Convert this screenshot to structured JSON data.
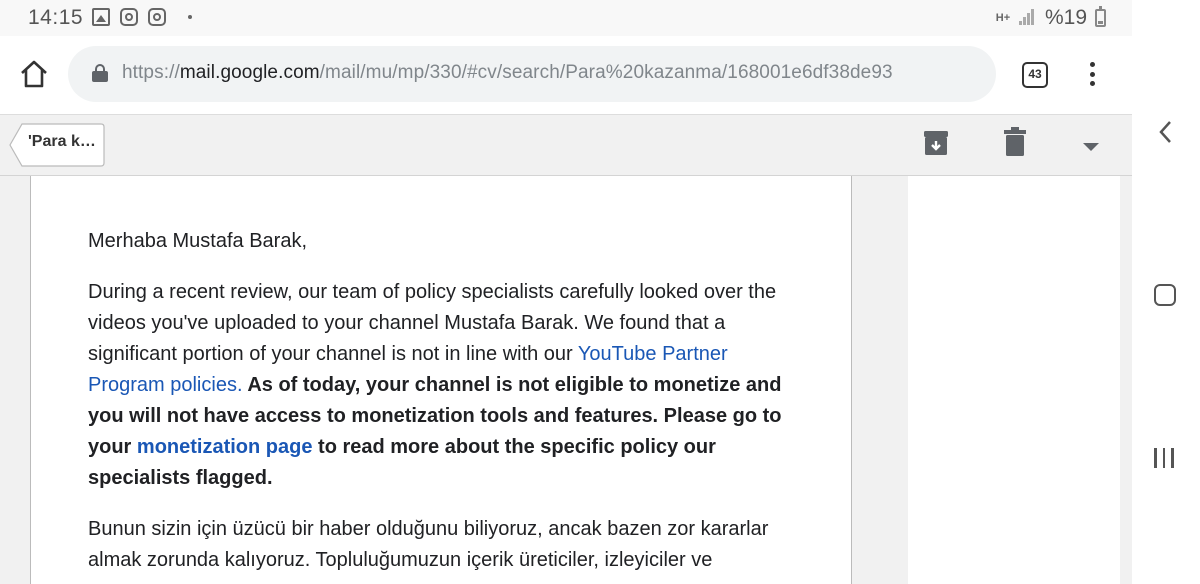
{
  "status_bar": {
    "time": "14:15",
    "notification_icons": [
      "gallery-icon",
      "instagram-icon",
      "instagram-icon",
      "dot-icon"
    ],
    "network_label": "H+",
    "battery_text": "%19"
  },
  "browser": {
    "url_scheme": "https://",
    "url_host": "mail.google.com",
    "url_path": "/mail/mu/mp/330/#cv/search/Para%20kazanma/168001e6df38de93",
    "tab_count": "43"
  },
  "toolbar": {
    "back_label": "'Para k…",
    "icons": [
      "archive-icon",
      "delete-icon",
      "dropdown-icon"
    ]
  },
  "email": {
    "greeting": "Merhaba Mustafa Barak,",
    "p1_text1": "During a recent review, our team of policy specialists carefully looked over the videos you've uploaded to your channel Mustafa Barak. We found that a significant portion of your channel is not in line with our ",
    "p1_link1": "YouTube Partner Program policies.",
    "p1_bold1": " As of today, your channel is not eligible to monetize and you will not have access to monetization tools and features. Please go to your ",
    "p1_link2": "monetization page",
    "p1_bold2": " to read more about the specific policy our specialists flagged.",
    "p2_text": "Bunun sizin için üzücü bir haber olduğunu biliyoruz, ancak bazen zor kararlar almak zorunda kalıyoruz. Topluluğumuzun içerik üreticiler, izleyiciler ve"
  },
  "colors": {
    "link": "#1a57b5",
    "toolbar_bg": "#f1f1f1"
  }
}
